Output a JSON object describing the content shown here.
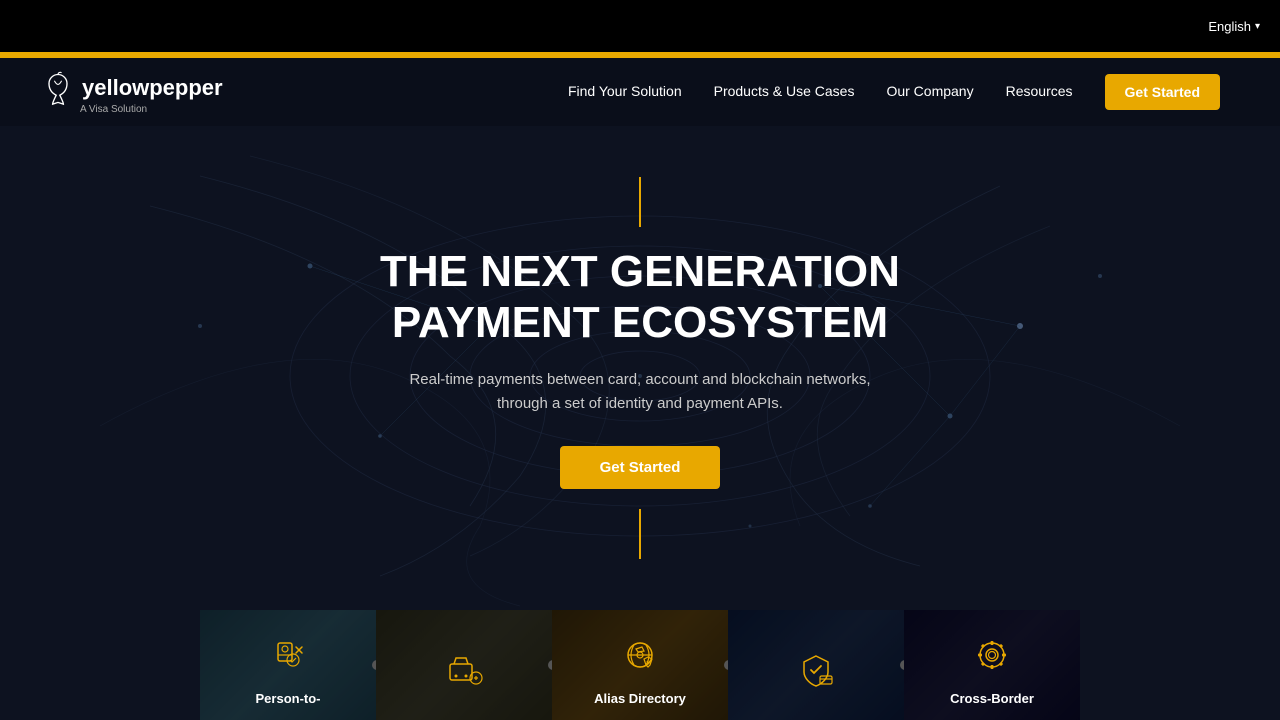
{
  "topBar": {
    "lang": "English",
    "chevron": "▾"
  },
  "accentBar": {
    "color": "#E8A800"
  },
  "navbar": {
    "logoText": "yellowpepper",
    "logoSubtitle": "A Visa Solution",
    "navItems": [
      {
        "id": "find-solution",
        "label": "Find Your Solution"
      },
      {
        "id": "products-use-cases",
        "label": "Products & Use Cases"
      },
      {
        "id": "our-company",
        "label": "Our Company"
      },
      {
        "id": "resources",
        "label": "Resources"
      }
    ],
    "ctaLabel": "Get Started"
  },
  "hero": {
    "title": "THE NEXT GENERATION\nPAYMENT ECOSYSTEM",
    "subtitle": "Real-time payments between card, account and blockchain networks, through a set of identity and payment APIs.",
    "ctaLabel": "Get Started"
  },
  "cards": [
    {
      "id": "card-person-to",
      "label": "Person-to-",
      "iconType": "person-to"
    },
    {
      "id": "card-ecommerce",
      "label": "",
      "iconType": "ecommerce"
    },
    {
      "id": "card-alias-directory",
      "label": "Alias Directory",
      "iconType": "alias"
    },
    {
      "id": "card-payment-auth",
      "label": "",
      "iconType": "payment-auth"
    },
    {
      "id": "card-cross-border",
      "label": "Cross-Border",
      "iconType": "cross-border"
    }
  ]
}
